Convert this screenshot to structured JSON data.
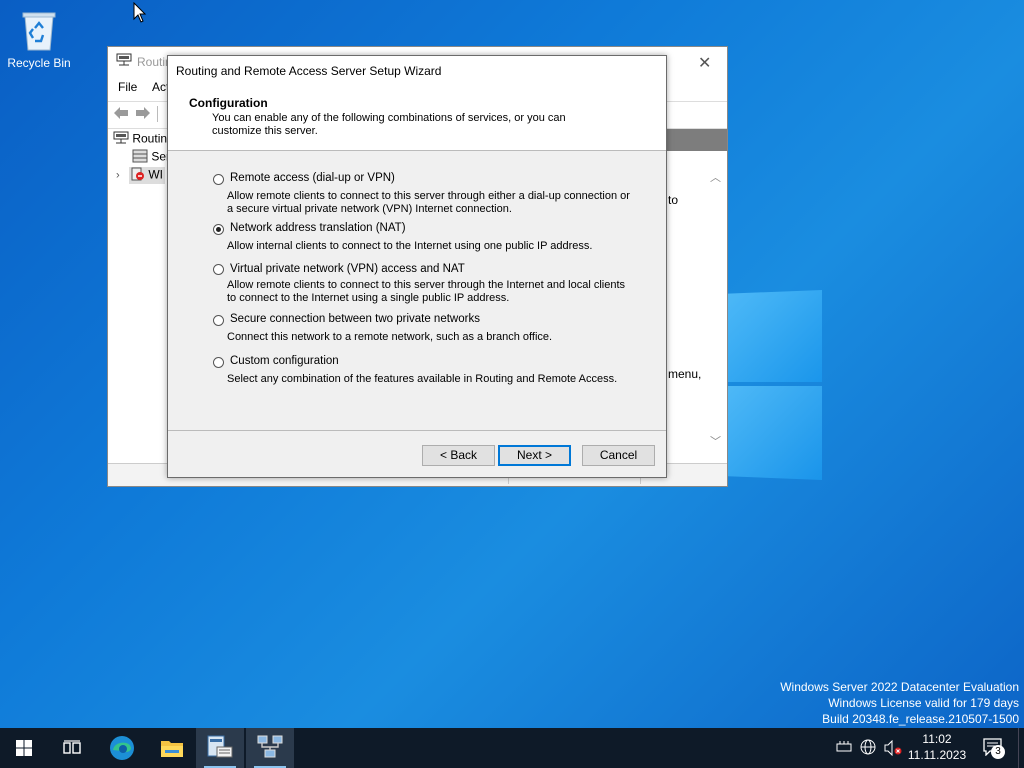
{
  "desktop": {
    "recycle_bin_label": "Recycle Bin",
    "watermark": {
      "line1": "Windows Server 2022 Datacenter Evaluation",
      "line2": "Windows License valid for 179 days",
      "line3": "Build 20348.fe_release.210507-1500"
    }
  },
  "mmc": {
    "title": "Routin",
    "menu": {
      "file": "File",
      "action": "Act"
    },
    "tree": {
      "root": "Routin",
      "item1": "Ser",
      "item2": "WI"
    },
    "right_text": {
      "frag1": "to",
      "frag2": "menu,"
    }
  },
  "wizard": {
    "title": "Routing and Remote Access Server Setup Wizard",
    "heading": "Configuration",
    "description": "You can enable any of the following combinations of services, or you can customize this server.",
    "options": [
      {
        "label": "Remote access (dial-up or VPN)",
        "desc": "Allow remote clients to connect to this server through either a dial-up connection or a secure virtual private network (VPN) Internet connection.",
        "selected": false
      },
      {
        "label": "Network address translation (NAT)",
        "desc": "Allow internal clients to connect to the Internet using one public IP address.",
        "selected": true
      },
      {
        "label": "Virtual private network (VPN) access and NAT",
        "desc": "Allow remote clients to connect to this server through the Internet and local clients to connect to the Internet using a single public IP address.",
        "selected": false
      },
      {
        "label": "Secure connection between two private networks",
        "desc": "Connect this network to a remote network, such as a branch office.",
        "selected": false
      },
      {
        "label": "Custom configuration",
        "desc": "Select any combination of the features available in Routing and Remote Access.",
        "selected": false
      }
    ],
    "buttons": {
      "back": "< Back",
      "next": "Next >",
      "cancel": "Cancel"
    }
  },
  "taskbar": {
    "time": "11:02",
    "date": "11.11.2023",
    "notification_count": "3"
  },
  "colors": {
    "accent": "#0078d7",
    "taskbar": "#0e1a28"
  }
}
